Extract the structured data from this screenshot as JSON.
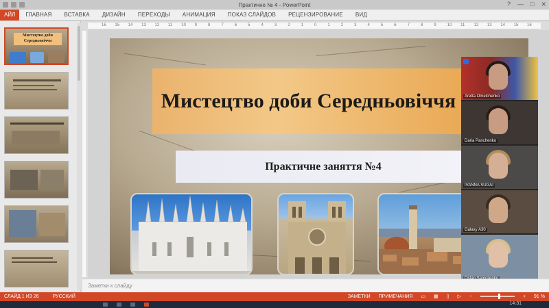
{
  "window": {
    "title": "Практичне № 4 - PowerPoint",
    "controls": [
      "?",
      "—",
      "□",
      "✕"
    ]
  },
  "ribbon": {
    "file_tab": "АЙЛ",
    "tabs": [
      "ГЛАВНАЯ",
      "ВСТАВКА",
      "ДИЗАЙН",
      "ПЕРЕХОДЫ",
      "АНИМАЦИЯ",
      "ПОКАЗ СЛАЙДОВ",
      "РЕЦЕНЗИРОВАНИЕ",
      "ВИД"
    ]
  },
  "thumbnails": {
    "numbers": [
      "1",
      "2",
      "3",
      "4",
      "5",
      "6"
    ],
    "slide1_title": "Мистецтво доби Середньовіччя",
    "selected_index": 0
  },
  "ruler": {
    "labels": [
      "16",
      "15",
      "14",
      "13",
      "12",
      "11",
      "10",
      "9",
      "8",
      "7",
      "6",
      "5",
      "4",
      "3",
      "2",
      "1",
      "0",
      "1",
      "2",
      "3",
      "4",
      "5",
      "6",
      "7",
      "8",
      "9",
      "10",
      "11",
      "12",
      "13",
      "14",
      "15",
      "16"
    ]
  },
  "slide": {
    "title": "Мистецтво доби Середньовіччя",
    "subtitle": "Практичне заняття №4"
  },
  "call": {
    "participants": [
      {
        "name": "Aretta Omelchenko"
      },
      {
        "name": "Daria Panchenko"
      },
      {
        "name": "IVANNA SUGAI"
      },
      {
        "name": "Galaxy A30"
      },
      {
        "name": "Ostap Samoilenko"
      }
    ]
  },
  "notes": {
    "placeholder": "Заметки к слайду"
  },
  "status": {
    "slide_counter": "СЛАЙД 1 ИЗ 26",
    "language": "РУССКИЙ",
    "notes_btn": "ЗАМЕТКИ",
    "comments_btn": "ПРИМЕЧАНИЯ",
    "zoom": "91 %",
    "zoom_level_fraction": 0.55
  },
  "taskbar": {
    "clock": "14:31"
  },
  "colors": {
    "accent": "#d24726",
    "title_box": "#f3c887",
    "subtitle_box": "#eeeef5"
  }
}
